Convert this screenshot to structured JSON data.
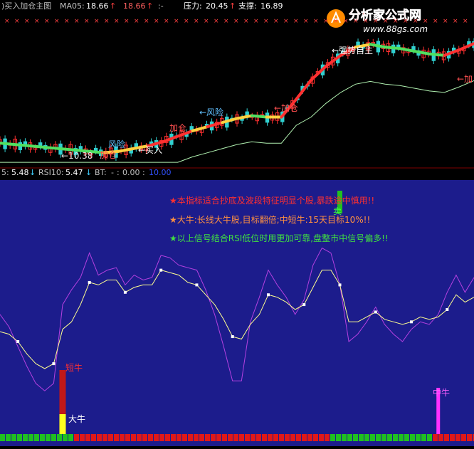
{
  "top_bar": {
    "indicator_name": ")买入加仓主图",
    "ma_label": "MA05:",
    "ma_value": "18.66",
    "ma_value2": "18.66",
    "dash": ":-",
    "pressure_label": "压力:",
    "pressure_value": "20.45",
    "support_label": "支撑:",
    "support_value": "16.89"
  },
  "logo": {
    "title": "分析家公式网",
    "url": "www.88gs.com"
  },
  "mid_bar": {
    "rsi5_label": "5:",
    "rsi5_value": "5.48",
    "rsi10_label": "RSI10:",
    "rsi10_value": "5.47",
    "bt_label": "BT:",
    "bt_value1": "0.00",
    "bt_value2": "10.00"
  },
  "price_annotations": {
    "price_low": "←10.38",
    "buy": "←买入",
    "add1": "加仓",
    "add2": "加仓",
    "add3": "←加仓",
    "risk1": "风险",
    "risk2": "←风险",
    "strong": "←强势自主",
    "add_right": "←加"
  },
  "notes": [
    "★本指标适合抄底及波段特征明显个股,暴跌途中慎用!!",
    "★大牛:长线大牛股,目标翻倍;中短牛:15天目标10%!!",
    "★以上信号结合RSI低位时用更加可靠,盘整市中信号偏多!!"
  ],
  "signals": {
    "short_bull": "短牛",
    "big_bull": "大牛",
    "mid_bull": "中牛",
    "sell": "卖"
  },
  "colors": {
    "lower_bg": "#1c1c8c",
    "rsi_fast": "#b540e0",
    "rsi_slow": "#ffff90",
    "note_red": "#ff3030",
    "note_orange": "#ff9040",
    "note_green": "#40e040",
    "up_candle": "#ff3030",
    "down_candle": "#30d0d0",
    "support_line": "#b0f0b0"
  },
  "chart_data": [
    {
      "type": "line",
      "title": "买入加仓主图",
      "series": [
        {
          "name": "MA05",
          "values": [
            11.4,
            11.3,
            11.2,
            11.1,
            11.0,
            10.9,
            10.8,
            10.7,
            10.8,
            11.0,
            11.2,
            11.5,
            11.9,
            12.3,
            12.6,
            12.9,
            13.2,
            13.4,
            13.3,
            13.3,
            14.6,
            16.0,
            17.0,
            17.8,
            18.4,
            18.6,
            18.4,
            18.3,
            18.1,
            17.9,
            17.8,
            18.2,
            18.66
          ]
        }
      ],
      "levels": {
        "pressure": 20.45,
        "support": 16.89,
        "low": 10.38
      }
    },
    {
      "type": "line",
      "title": "RSI",
      "ylim": [
        0,
        100
      ],
      "series": [
        {
          "name": "RSI5",
          "values": [
            48,
            43,
            35,
            27,
            20,
            17,
            20,
            52,
            58,
            63,
            73,
            64,
            66,
            67,
            60,
            64,
            62,
            63,
            72,
            71,
            68,
            67,
            66,
            58,
            48,
            35,
            21,
            21,
            45,
            55,
            66,
            60,
            55,
            48,
            54,
            68,
            75,
            73,
            60,
            37,
            40,
            45,
            51,
            44,
            40,
            37,
            42,
            45,
            44,
            48,
            57,
            64,
            57,
            63
          ]
        },
        {
          "name": "RSI10",
          "values": [
            41,
            40,
            37,
            32,
            28,
            26,
            28,
            42,
            45,
            52,
            61,
            60,
            62,
            62,
            57,
            59,
            60,
            60,
            66,
            65,
            64,
            61,
            60,
            56,
            52,
            46,
            39,
            38,
            44,
            48,
            56,
            55,
            53,
            50,
            52,
            59,
            66,
            66,
            60,
            45,
            45,
            47,
            49,
            46,
            45,
            44,
            45,
            47,
            46,
            47,
            50,
            56,
            53,
            55
          ]
        }
      ],
      "signals": [
        {
          "label": "短牛",
          "index": 7
        },
        {
          "label": "大牛",
          "index": 7
        },
        {
          "label": "卖",
          "index": 38
        },
        {
          "label": "中牛",
          "index": 49
        }
      ]
    }
  ]
}
